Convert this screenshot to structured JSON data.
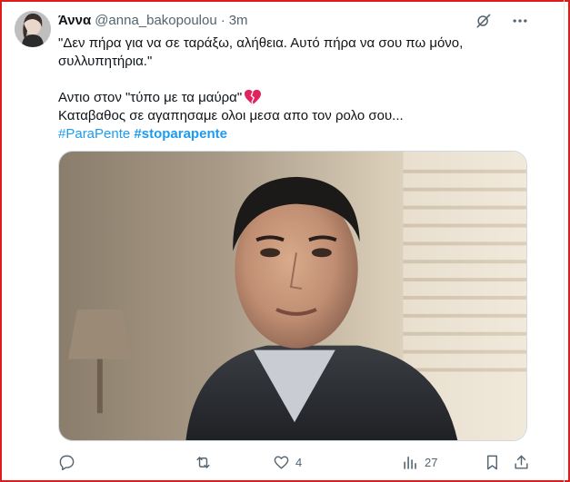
{
  "tweet": {
    "display_name": "Άννα",
    "handle": "@anna_bakopoulou",
    "separator": "·",
    "time": "3m",
    "line1": "\"Δεν πήρα για να σε ταράξω, αλήθεια. Αυτό πήρα να σου πω μόνο,",
    "line2": "συλλυπητήρια.\"",
    "line3": "Αντιο στον \"τύπο με τα μαύρα\"",
    "line4": "Καταβαθος σε αγαπησαμε ολοι μεσα απο τον ρολο σου...",
    "hashtag1": "#ParaPente",
    "hashtag2": "#stoparapente",
    "emoji": "broken-heart-icon"
  },
  "actions": {
    "reply_count": "",
    "retweet_count": "",
    "like_count": "4",
    "views_count": "27"
  },
  "colors": {
    "border": "#e01b1b",
    "link": "#1d9bf0",
    "muted": "#536471",
    "text": "#0f1419"
  }
}
